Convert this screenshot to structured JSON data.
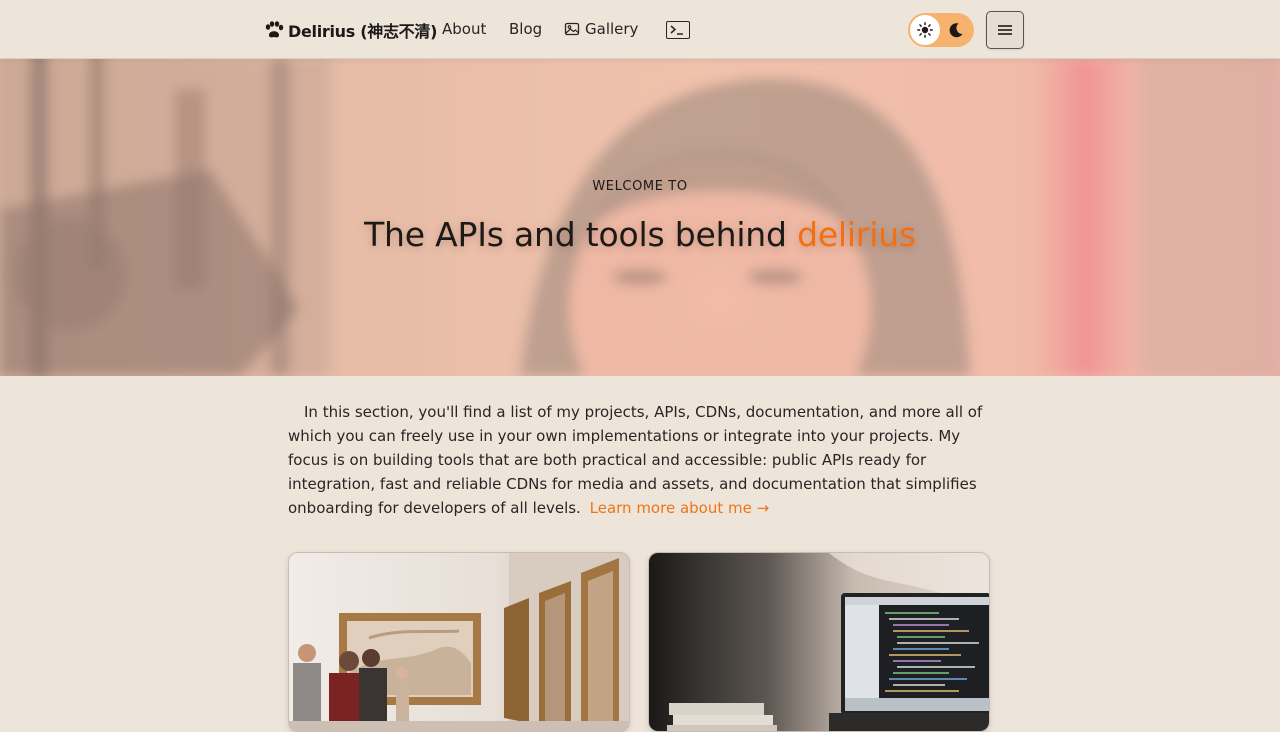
{
  "nav": {
    "brand": "Delirius (神志不清)",
    "links": [
      {
        "label": "About"
      },
      {
        "label": "Blog"
      },
      {
        "label": "Gallery"
      }
    ],
    "theme_toggle": {
      "state": "light"
    },
    "icons": {
      "brand": "paw-icon",
      "gallery": "image-icon",
      "terminal": "terminal-icon",
      "sun": "sun-icon",
      "moon": "moon-icon",
      "menu": "hamburger-icon"
    }
  },
  "hero": {
    "kicker": "WELCOME TO",
    "title": "The APIs and tools behind",
    "title_accent": "delirius"
  },
  "intro": {
    "text": "In this section, you'll find a list of my projects, APIs, CDNs, documentation, and more all of which you can freely use in your own implementations or integrate into your projects. My focus is on building tools that are both practical and accessible: public APIs ready for integration, fast and reliable CDNs for media and assets, and documentation that simplifies onboarding for developers of all levels.",
    "link_label": "Learn more about me →"
  },
  "cards": [
    {
      "image": "gallery-visitors-photo"
    },
    {
      "image": "laptop-code-photo"
    }
  ],
  "colors": {
    "background": "#ede5da",
    "accent": "#f26f12",
    "toggle": "#f7b26e"
  }
}
